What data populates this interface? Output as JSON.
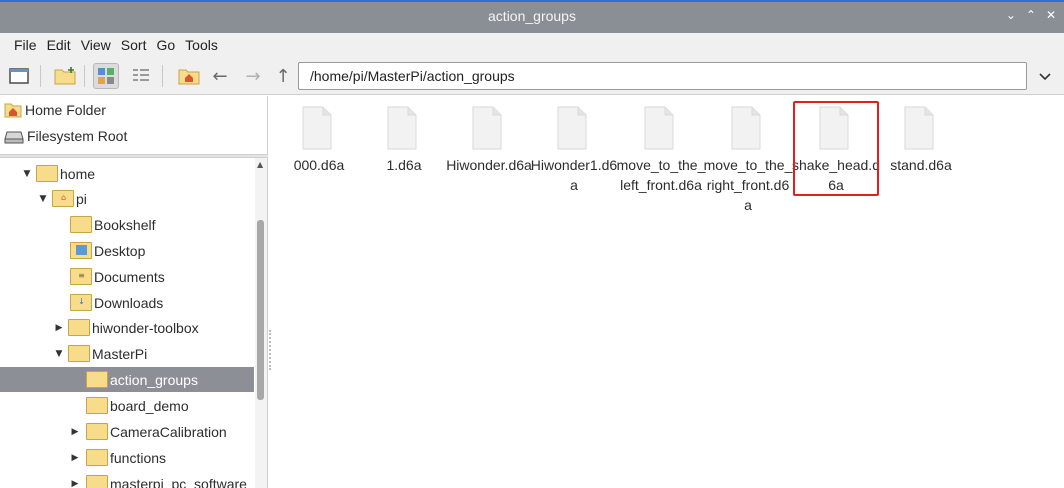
{
  "window": {
    "title": "action_groups"
  },
  "menu": [
    "File",
    "Edit",
    "View",
    "Sort",
    "Go",
    "Tools"
  ],
  "toolbar": {
    "path": "/home/pi/MasterPi/action_groups"
  },
  "places": [
    {
      "label": "Home Folder",
      "icon": "home-icon"
    },
    {
      "label": "Filesystem Root",
      "icon": "drive-icon"
    }
  ],
  "tree": [
    {
      "label": "home",
      "expander": "open",
      "icon": "folder-icon"
    },
    {
      "label": "pi",
      "expander": "open",
      "icon": "home-folder-icon"
    },
    {
      "label": "Bookshelf",
      "expander": "none",
      "icon": "folder-icon"
    },
    {
      "label": "Desktop",
      "expander": "none",
      "icon": "desktop-folder-icon"
    },
    {
      "label": "Documents",
      "expander": "none",
      "icon": "documents-folder-icon"
    },
    {
      "label": "Downloads",
      "expander": "none",
      "icon": "downloads-folder-icon"
    },
    {
      "label": "hiwonder-toolbox",
      "expander": "closed",
      "icon": "folder-icon"
    },
    {
      "label": "MasterPi",
      "expander": "open",
      "icon": "folder-icon"
    },
    {
      "label": "action_groups",
      "expander": "none",
      "icon": "folder-icon",
      "selected": true
    },
    {
      "label": "board_demo",
      "expander": "none",
      "icon": "folder-icon"
    },
    {
      "label": "CameraCalibration",
      "expander": "closed",
      "icon": "folder-icon"
    },
    {
      "label": "functions",
      "expander": "closed",
      "icon": "folder-icon"
    },
    {
      "label": "masterpi_pc_software",
      "expander": "closed",
      "icon": "folder-icon"
    }
  ],
  "files": [
    {
      "name": "000.d6a"
    },
    {
      "name": "1.d6a"
    },
    {
      "name": "Hiwonder.d6a"
    },
    {
      "name": "Hiwonder1.d6a"
    },
    {
      "name": "move_to_the_left_front.d6a"
    },
    {
      "name": "move_to_the_right_front.d6a"
    },
    {
      "name": "shake_head.d6a",
      "highlighted": true
    },
    {
      "name": "stand.d6a"
    }
  ],
  "colors": {
    "selection": "#8c9096",
    "highlight_box": "#e02020",
    "folder": "#f7dc8c",
    "titlebar": "#8a8f96"
  }
}
